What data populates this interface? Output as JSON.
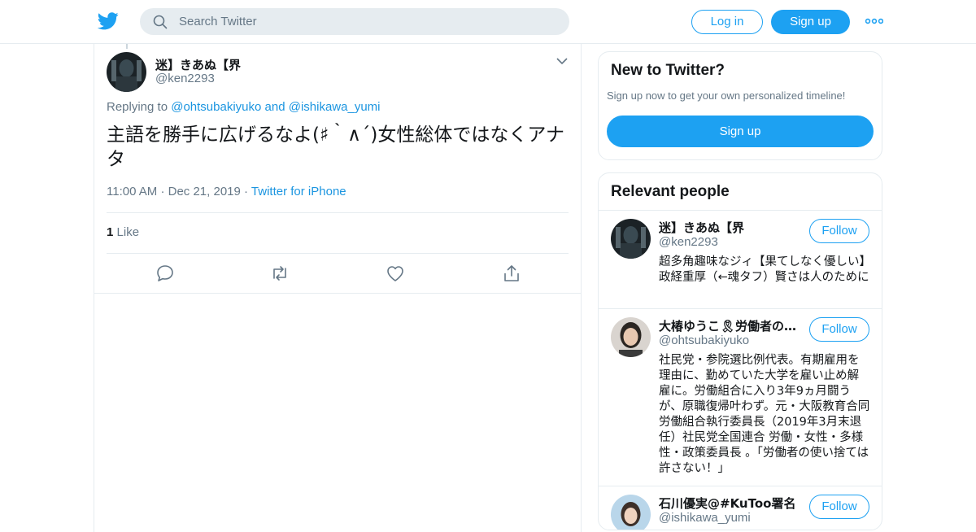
{
  "header": {
    "search_placeholder": "Search Twitter",
    "login_label": "Log in",
    "signup_label": "Sign up",
    "logo_icon": "twitter-bird-icon",
    "more_icon": "more-dots-icon",
    "brand_color": "#1da1f2"
  },
  "tweet": {
    "display_name": "迷】きあぬ【界",
    "handle": "@ken2293",
    "replying_prefix": "Replying to",
    "replying_user1": "@ohtsubakiyuko",
    "replying_and": "and",
    "replying_user2": "@ishikawa_yumi",
    "text": "主語を勝手に広げるなよ(♯｀∧´)女性総体ではなくアナタ",
    "time": "11:00 AM",
    "date": "Dec 21, 2019",
    "source": "Twitter for iPhone",
    "likes_count": "1",
    "likes_label": "Like",
    "actions": [
      "reply-icon",
      "retweet-icon",
      "like-icon",
      "share-icon"
    ]
  },
  "new_to_twitter": {
    "title": "New to Twitter?",
    "subtitle": "Sign up now to get your own personalized timeline!",
    "signup_label": "Sign up"
  },
  "relevant": {
    "title": "Relevant people",
    "people": [
      {
        "name": "迷】きあぬ【界",
        "handle": "@ken2293",
        "follow_label": "Follow",
        "bio": "超多角趣味なジィ【果てしなく優しい】政経重厚（←魂タフ）賢さは人のために"
      },
      {
        "name": "大椿ゆうこ🎗労働者の使い捨ては許さない",
        "handle": "@ohtsubakiyuko",
        "follow_label": "Follow",
        "bio": "社民党・参院選比例代表。有期雇用を理由に、勤めていた大学を雇い止め解雇に。労働組合に入り3年9ヵ月闘うが、原職復帰叶わず。元・大阪教育合同労働組合執行委員長（2019年3月末退任）社民党全国連合 労働・女性・多様性・政策委員長 。「労働者の使い捨ては許さない！」"
      },
      {
        "name": "石川優実@#KuToo署名",
        "handle": "@ishikawa_yumi",
        "follow_label": "Follow",
        "bio": ""
      }
    ]
  }
}
